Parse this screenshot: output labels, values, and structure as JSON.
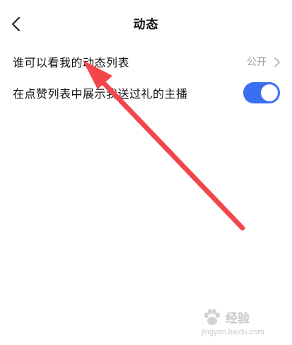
{
  "header": {
    "title": "动态",
    "back_icon": "chevron-left-icon"
  },
  "settings": {
    "rows": [
      {
        "label": "谁可以看我的动态列表",
        "value": "公开",
        "icon": "chevron-right-icon"
      },
      {
        "label": "在点赞列表中展示我送过礼的主播",
        "toggle_on": true,
        "toggle_color": "#3b6ff2"
      }
    ]
  },
  "annotation": {
    "arrow_color": "#f2464a",
    "arrow_icon": "red-arrow-annotation"
  },
  "watermark": {
    "text": "经验",
    "url": "jingyan.baidu.com"
  }
}
